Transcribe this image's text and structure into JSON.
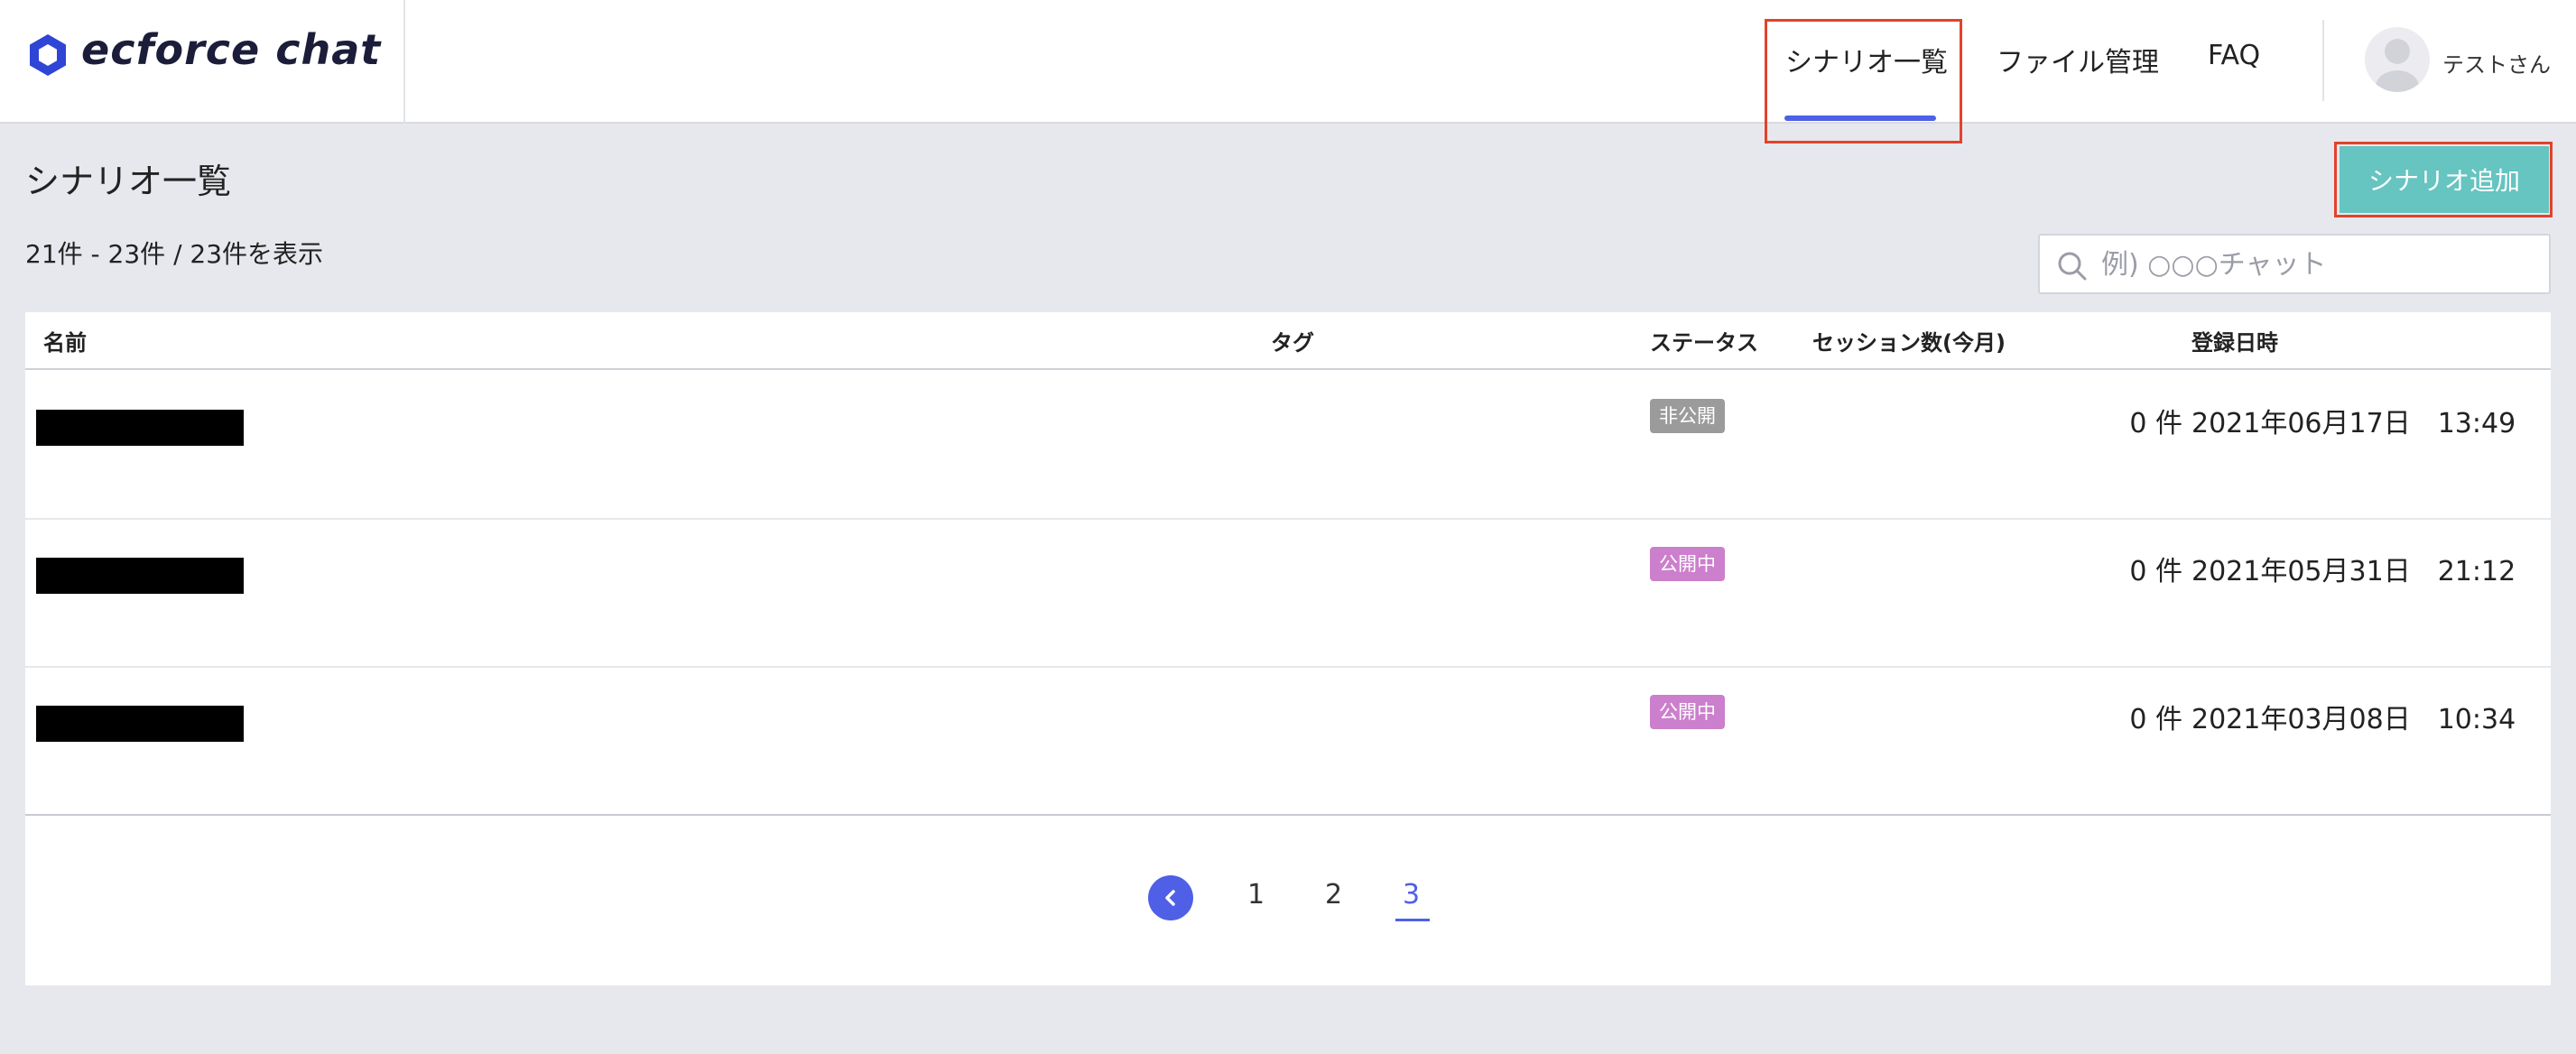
{
  "brand": {
    "name": "ecforce chat",
    "logo_color": "#2f45d6"
  },
  "nav": {
    "items": [
      {
        "label": "シナリオ一覧",
        "active": true
      },
      {
        "label": "ファイル管理"
      },
      {
        "label": "FAQ"
      }
    ],
    "accent": "#4f60e6"
  },
  "user": {
    "name": "テストさん",
    "avatar_icon": "user-avatar-icon"
  },
  "page": {
    "title": "シナリオ一覧",
    "count_text": "21件 - 23件 / 23件を表示",
    "add_button": "シナリオ追加",
    "add_button_color": "#66c4c1"
  },
  "search": {
    "placeholder": "例) ○○○チャット",
    "value": "",
    "icon": "search-icon"
  },
  "table": {
    "headers": [
      "名前",
      "タグ",
      "ステータス",
      "セッション数(今月)",
      "登録日時"
    ],
    "rows": [
      {
        "name": "",
        "tag": "",
        "status": "非公開",
        "status_color": "#9b9b9b",
        "sessions": "0 件",
        "registered": "2021年06月17日　13:49"
      },
      {
        "name": "",
        "tag": "",
        "status": "公開中",
        "status_color": "#cc7fcc",
        "sessions": "0 件",
        "registered": "2021年05月31日　21:12"
      },
      {
        "name": "",
        "tag": "",
        "status": "公開中",
        "status_color": "#cc7fcc",
        "sessions": "0 件",
        "registered": "2021年03月08日　10:34"
      }
    ]
  },
  "pagination": {
    "pages": [
      "1",
      "2",
      "3"
    ],
    "current": "3",
    "prev_icon": "chevron-left-icon"
  },
  "highlight_color": "#e2422c"
}
